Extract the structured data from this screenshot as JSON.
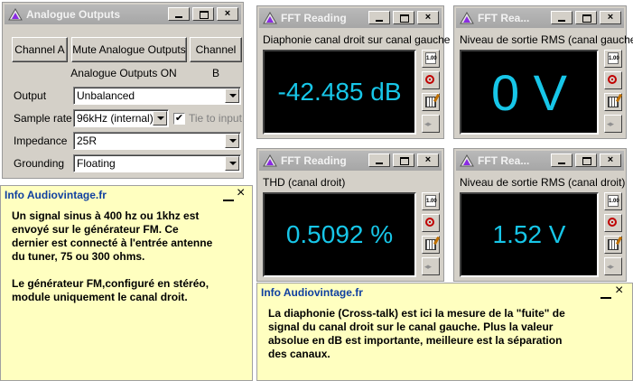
{
  "analogue": {
    "title": "Analogue Outputs",
    "buttons": {
      "channel_a": "Channel A",
      "mute": "Mute Analogue Outputs",
      "channel_b": "Channel B"
    },
    "status": "Analogue Outputs ON",
    "output": {
      "label": "Output",
      "value": "Unbalanced"
    },
    "sample_rate": {
      "label": "Sample rate",
      "value": "96kHz (internal)"
    },
    "tie": {
      "label": "Tie to input",
      "checked": true
    },
    "impedance": {
      "label": "Impedance",
      "value": "25R"
    },
    "grounding": {
      "label": "Grounding",
      "value": "Floating"
    }
  },
  "fft": [
    {
      "title": "FFT Reading",
      "caption": "Diaphonie canal droit sur canal gauche",
      "value": "-42.485 dB"
    },
    {
      "title": "FFT Rea...",
      "caption": "Niveau de sortie RMS (canal gauche)",
      "value": "0 V"
    },
    {
      "title": "FFT Reading",
      "caption": "THD (canal droit)",
      "value": "0.5092 %"
    },
    {
      "title": "FFT Rea...",
      "caption": "Niveau de sortie RMS (canal droit)",
      "value": "1.52 V"
    }
  ],
  "side_icons": {
    "scale_text": "1.00"
  },
  "info1": {
    "title": "Info Audiovintage.fr",
    "text": "Un signal sinus à 400 hz ou 1khz est\nenvoyé sur le générateur FM. Ce\ndernier est connecté à l'entrée antenne\ndu tuner, 75 ou 300 ohms.\n\nLe générateur FM,configuré en stéréo,\nmodule uniquement le canal droit."
  },
  "info2": {
    "title": "Info Audiovintage.fr",
    "text": "La diaphonie (Cross-talk) est ici la mesure de la \"fuite\" de\nsignal du canal droit sur le canal gauche. Plus la valeur\nabsolue en dB est importante, meilleure est la séparation\ndes canaux."
  },
  "icons": {
    "close": "×",
    "check": "✔"
  },
  "colors": {
    "readout": "#17c6e8",
    "info_bg": "#ffffc0",
    "info_title": "#1040a0"
  }
}
